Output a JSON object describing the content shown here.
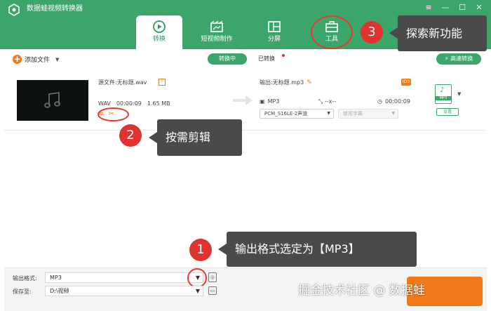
{
  "app": {
    "title": "数据蛙视频转换器",
    "window_controls": [
      "≡",
      "—",
      "☐",
      "✕"
    ]
  },
  "nav": {
    "tabs": [
      {
        "label": "转换",
        "icon": "convert-icon",
        "active": true
      },
      {
        "label": "短视频制作",
        "icon": "video-maker-icon",
        "active": false
      },
      {
        "label": "分屏",
        "icon": "split-screen-icon",
        "active": false
      },
      {
        "label": "工具",
        "icon": "toolbox-icon",
        "active": false
      }
    ]
  },
  "toolbar": {
    "add_file_label": "添加文件",
    "converting_label": "转换中",
    "converted_label": "已转换",
    "high_speed_label": "高速转换"
  },
  "file": {
    "source_label": "源文件:无标题.wav",
    "src_format": "WAV",
    "src_duration": "00:00:09",
    "src_size": "1.65 MB",
    "output_label": "输出:无标题.mp3",
    "out_format": "MP3",
    "out_resolution": "--x--",
    "out_duration": "00:00:09",
    "audio_track": "PCM_S16LE-2声道",
    "subtitle": "禁用字幕",
    "format_badge": "MP3",
    "setting_label": "设置"
  },
  "bottom": {
    "format_label": "输出格式:",
    "format_value": "MP3",
    "save_label": "保存至:",
    "save_value": "D:\\视频"
  },
  "annotations": {
    "badge_1": "1",
    "callout_1": "输出格式选定为【MP3】",
    "badge_2": "2",
    "callout_2": "按需剪辑",
    "badge_3": "3",
    "callout_3": "探索新功能"
  },
  "watermark": "掘金技术社区 @ 数据蛙",
  "colors": {
    "brand_green": "#3ca66a",
    "accent_orange": "#f27a1a",
    "annotation_red": "#e0322f",
    "callout_gray": "#4a4a4a"
  }
}
